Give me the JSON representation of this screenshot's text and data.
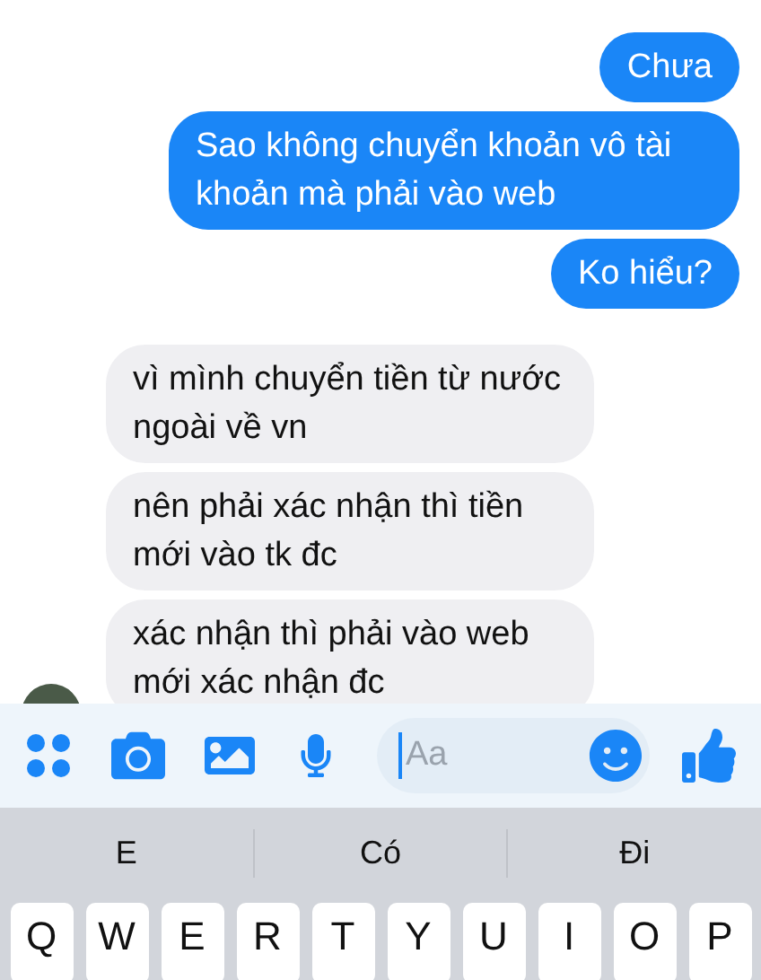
{
  "messages": [
    {
      "kind": "sent",
      "text": "Chưa"
    },
    {
      "kind": "sent",
      "text": "Sao không chuyển khoản vô tài khoản mà phải vào web"
    },
    {
      "kind": "sent",
      "text": "Ko hiểu?"
    },
    {
      "kind": "received",
      "text": "vì mình chuyển tiền từ nước ngoài về vn"
    },
    {
      "kind": "received",
      "text": "nên phải xác nhận thì tiền mới vào tk đc"
    },
    {
      "kind": "received",
      "text": "xác nhận thì phải vào web mới xác nhận đc"
    }
  ],
  "composer": {
    "placeholder": "Aa"
  },
  "suggestions": [
    "E",
    "Có",
    "Đi"
  ],
  "keys": [
    "Q",
    "W",
    "E",
    "R",
    "T",
    "Y",
    "U",
    "I",
    "O",
    "P"
  ]
}
